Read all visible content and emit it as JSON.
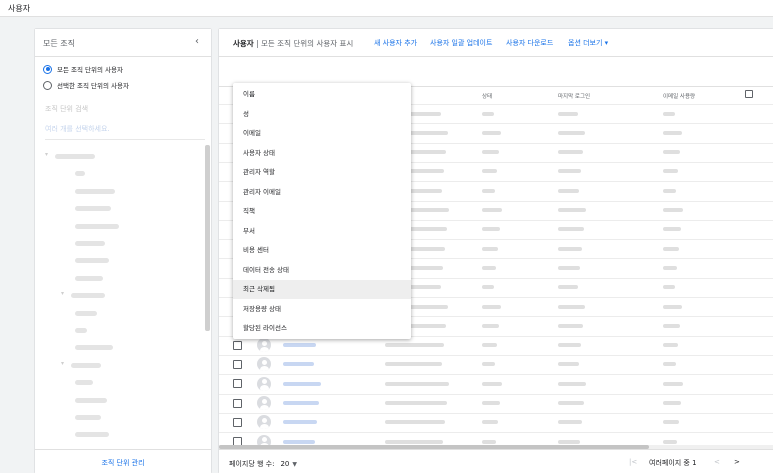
{
  "app": {
    "title": "사용자"
  },
  "left_panel": {
    "header": "모든 조직",
    "options": [
      {
        "label": "모든 조직 단위의 사용자",
        "selected": true
      },
      {
        "label": "선택한 조직 단위의 사용자",
        "selected": false
      }
    ],
    "search_label": "조직 단위 검색",
    "search_placeholder": "여러 개를 선택하세요.",
    "footer_link": "조직 단위 관리"
  },
  "right_panel": {
    "title_bold": "사용자",
    "title_rest": " | 모든 조직 단위의 사용자 표시",
    "actions": [
      "새 사용자 추가",
      "사용자 일괄 업데이트",
      "사용자 다운로드",
      "옵션 더보기 ▾"
    ],
    "columns": [
      "상태",
      "마지막 로그인",
      "이메일 사용량"
    ],
    "rows_per_page_label": "페이지당 행 수:",
    "rows_per_page_value": "20",
    "pagination_text": "여러페이지 중 1"
  },
  "column_menu": {
    "items": [
      "이름",
      "성",
      "이메일",
      "사용자 상태",
      "관리자 역할",
      "관리자 이메일",
      "직책",
      "부서",
      "비용 센터",
      "데이터 전송 상태",
      "최근 삭제됨",
      "저장용량 상태",
      "할당된 라이선스"
    ],
    "highlighted_index": 10
  },
  "colors": {
    "accent": "#1a73e8",
    "background": "#f1f3f4"
  }
}
